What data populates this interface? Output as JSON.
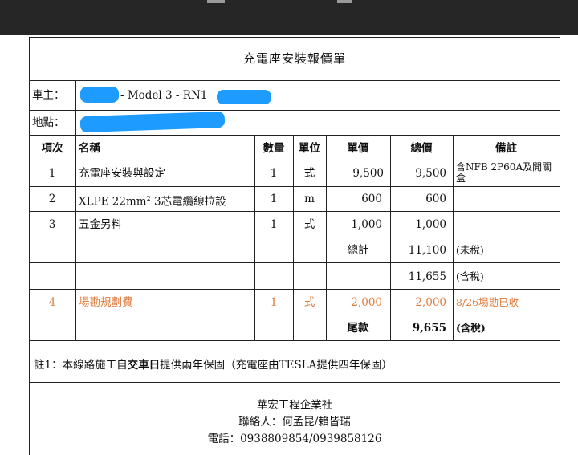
{
  "title": "充電座安裝報價單",
  "owner": {
    "label": "車主：",
    "value": "- Model 3 - RN1"
  },
  "location": {
    "label": "地點："
  },
  "headers": {
    "item": "項次",
    "name": "名稱",
    "qty": "數量",
    "unit": "單位",
    "price": "單價",
    "total": "總價",
    "remark": "備註"
  },
  "rows": [
    {
      "no": "1",
      "name": "充電座安裝與設定",
      "qty": "1",
      "unit": "式",
      "price": "9,500",
      "total": "9,500",
      "remark_line1": "含NFB 2P60A及開關",
      "remark_line2": "盒"
    },
    {
      "no": "2",
      "name_a": "XLPE 22mm",
      "name_sup": "2",
      "name_b": " 3芯電纜線拉設",
      "qty": "1",
      "unit": "m",
      "price": "600",
      "total": "600"
    },
    {
      "no": "3",
      "name": "五金另料",
      "qty": "1",
      "unit": "式",
      "price": "1,000",
      "total": "1,000"
    }
  ],
  "subtotal": {
    "label": "總計",
    "value": "11,100",
    "note": "(未稅)"
  },
  "taxed": {
    "value": "11,655",
    "note": "(含稅)"
  },
  "survey": {
    "no": "4",
    "name": "場勘規劃費",
    "qty": "1",
    "unit": "式",
    "price_sign": "-",
    "price": "2,000",
    "total_sign": "-",
    "total": "2,000",
    "remark": "8/26場勘已收"
  },
  "balance": {
    "label": "尾款",
    "value": "9,655",
    "note": "(含稅)"
  },
  "note": {
    "prefix": "註1：本線路施工自",
    "emph": "交車日",
    "suffix": "提供兩年保固（充電座由TESLA提供四年保固）"
  },
  "footer": {
    "company": "華宏工程企業社",
    "contact": "聯絡人：何孟昆/賴皆瑞",
    "phone": "電話：0938809854/0939858126"
  },
  "colors": {
    "accent": "#e07a3a",
    "redaction": "#1e9bff",
    "topbar": "#262626"
  }
}
